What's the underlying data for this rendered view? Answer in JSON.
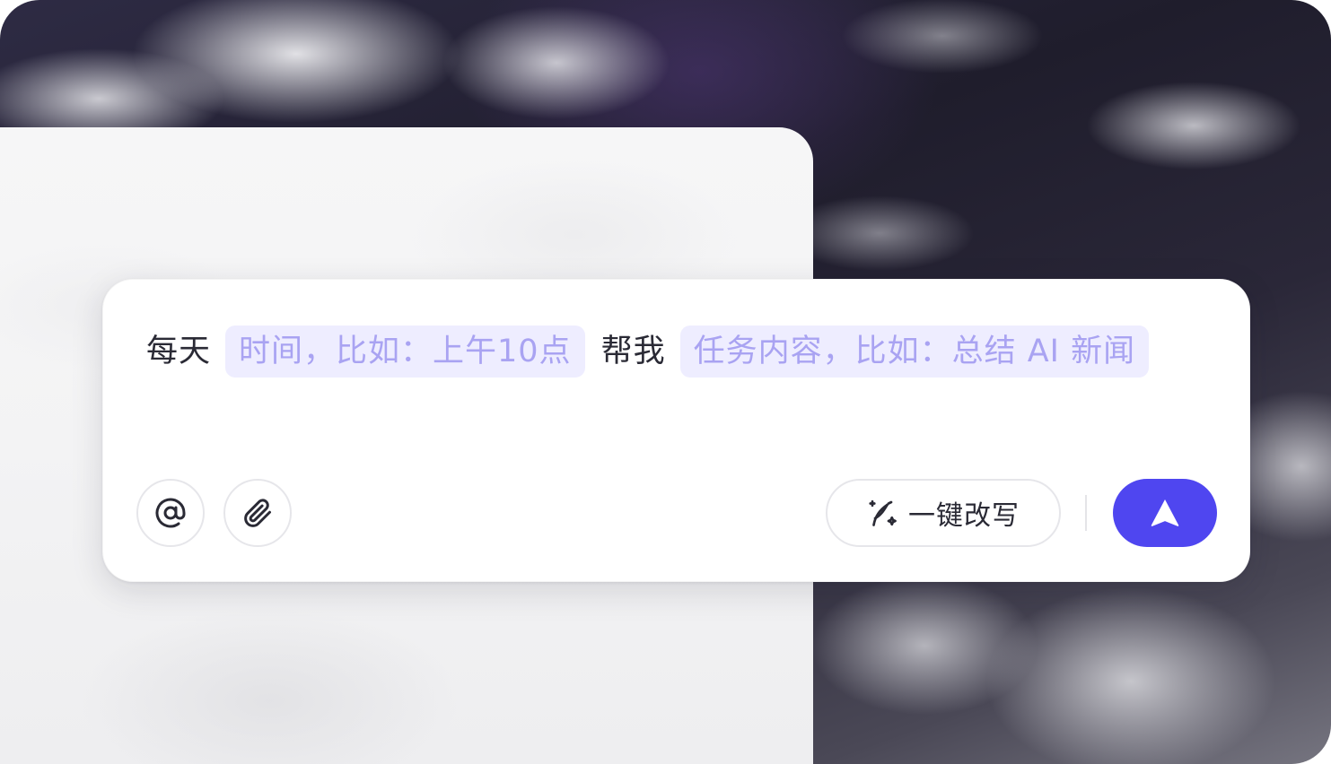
{
  "prompt": {
    "prefix": "每天",
    "time_placeholder": "时间，比如：上午10点",
    "middle": "帮我",
    "task_placeholder": "任务内容，比如：总结 AI 新闻"
  },
  "toolbar": {
    "mention_icon": "at-icon",
    "attach_icon": "paperclip-icon",
    "rewrite_icon": "sparkle-pen-icon",
    "rewrite_label": "一键改写",
    "send_icon": "send-arrow-icon"
  },
  "colors": {
    "accent": "#4f46f0",
    "slot_bg": "#eeedff",
    "slot_text": "#a9a3f2"
  }
}
